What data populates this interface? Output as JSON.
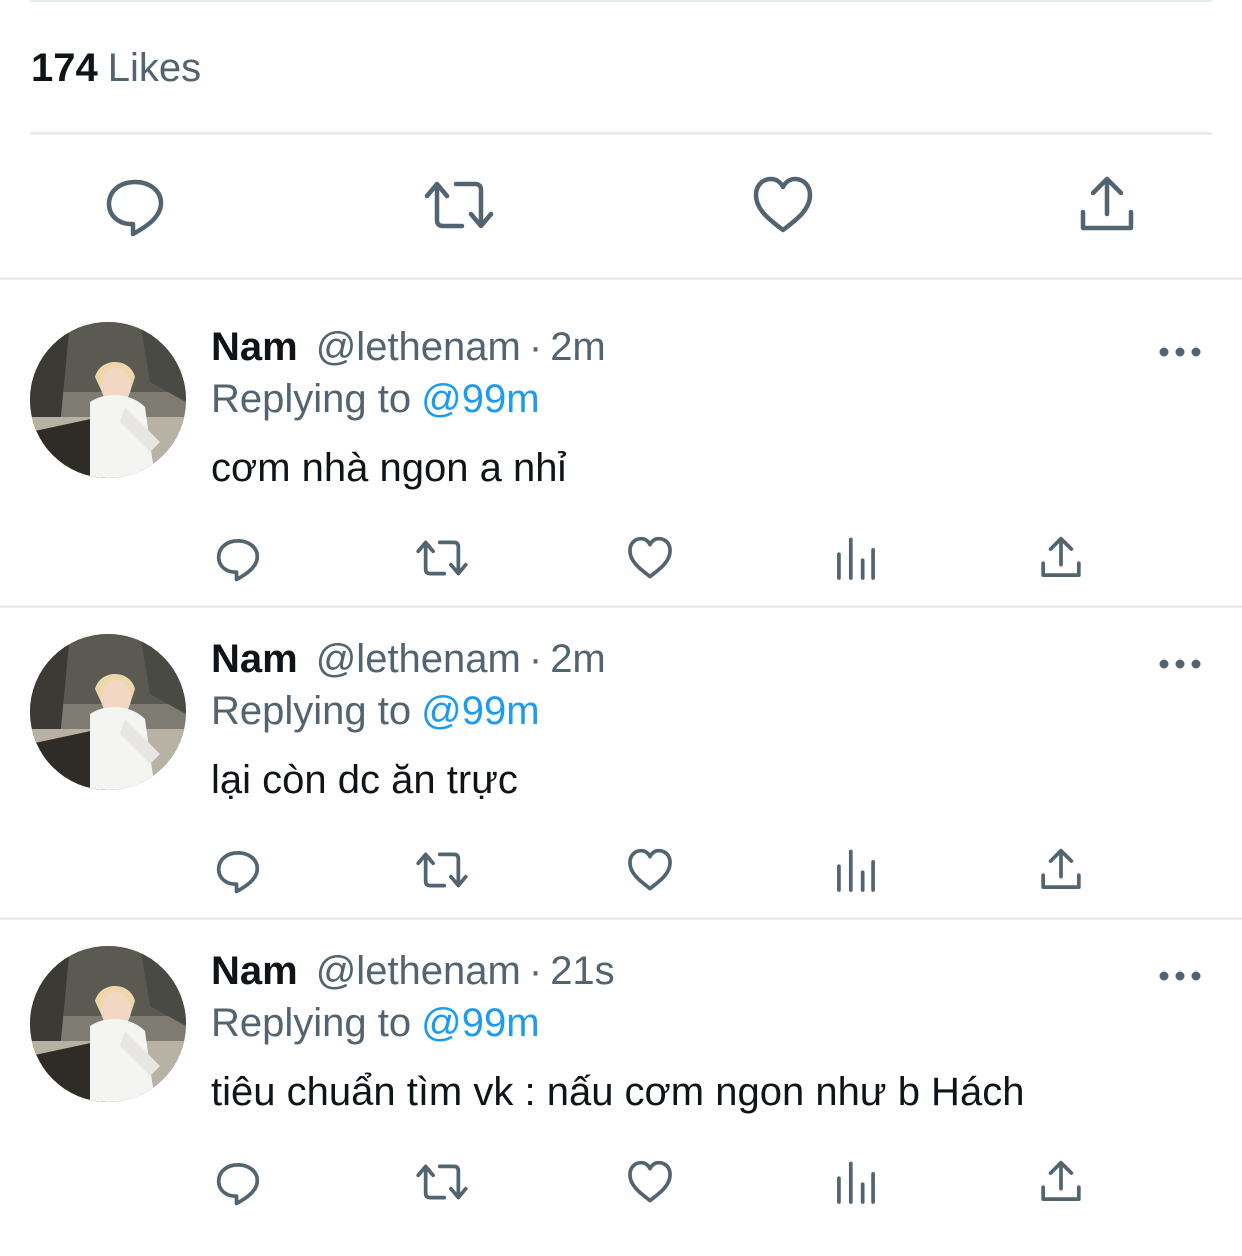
{
  "likes": {
    "count": "174",
    "label": "Likes"
  },
  "main_actions": {
    "icons": [
      "reply-icon",
      "retweet-icon",
      "like-icon",
      "share-icon"
    ]
  },
  "colors": {
    "icon": "#536471",
    "mention": "#1d9bf0",
    "divider": "#e6ecf0"
  },
  "replies": [
    {
      "name": "Nam",
      "handle": "@lethenam",
      "separator": "·",
      "time": "2m",
      "replying_label": "Replying to",
      "replying_to": "@99m",
      "text": "cơm nhà ngon a nhỉ"
    },
    {
      "name": "Nam",
      "handle": "@lethenam",
      "separator": "·",
      "time": "2m",
      "replying_label": "Replying to",
      "replying_to": "@99m",
      "text": "lại còn dc ăn trực"
    },
    {
      "name": "Nam",
      "handle": "@lethenam",
      "separator": "·",
      "time": "21s",
      "replying_label": "Replying to",
      "replying_to": "@99m",
      "text": "tiêu chuẩn tìm vk : nấu cơm ngon như b Hách"
    }
  ]
}
